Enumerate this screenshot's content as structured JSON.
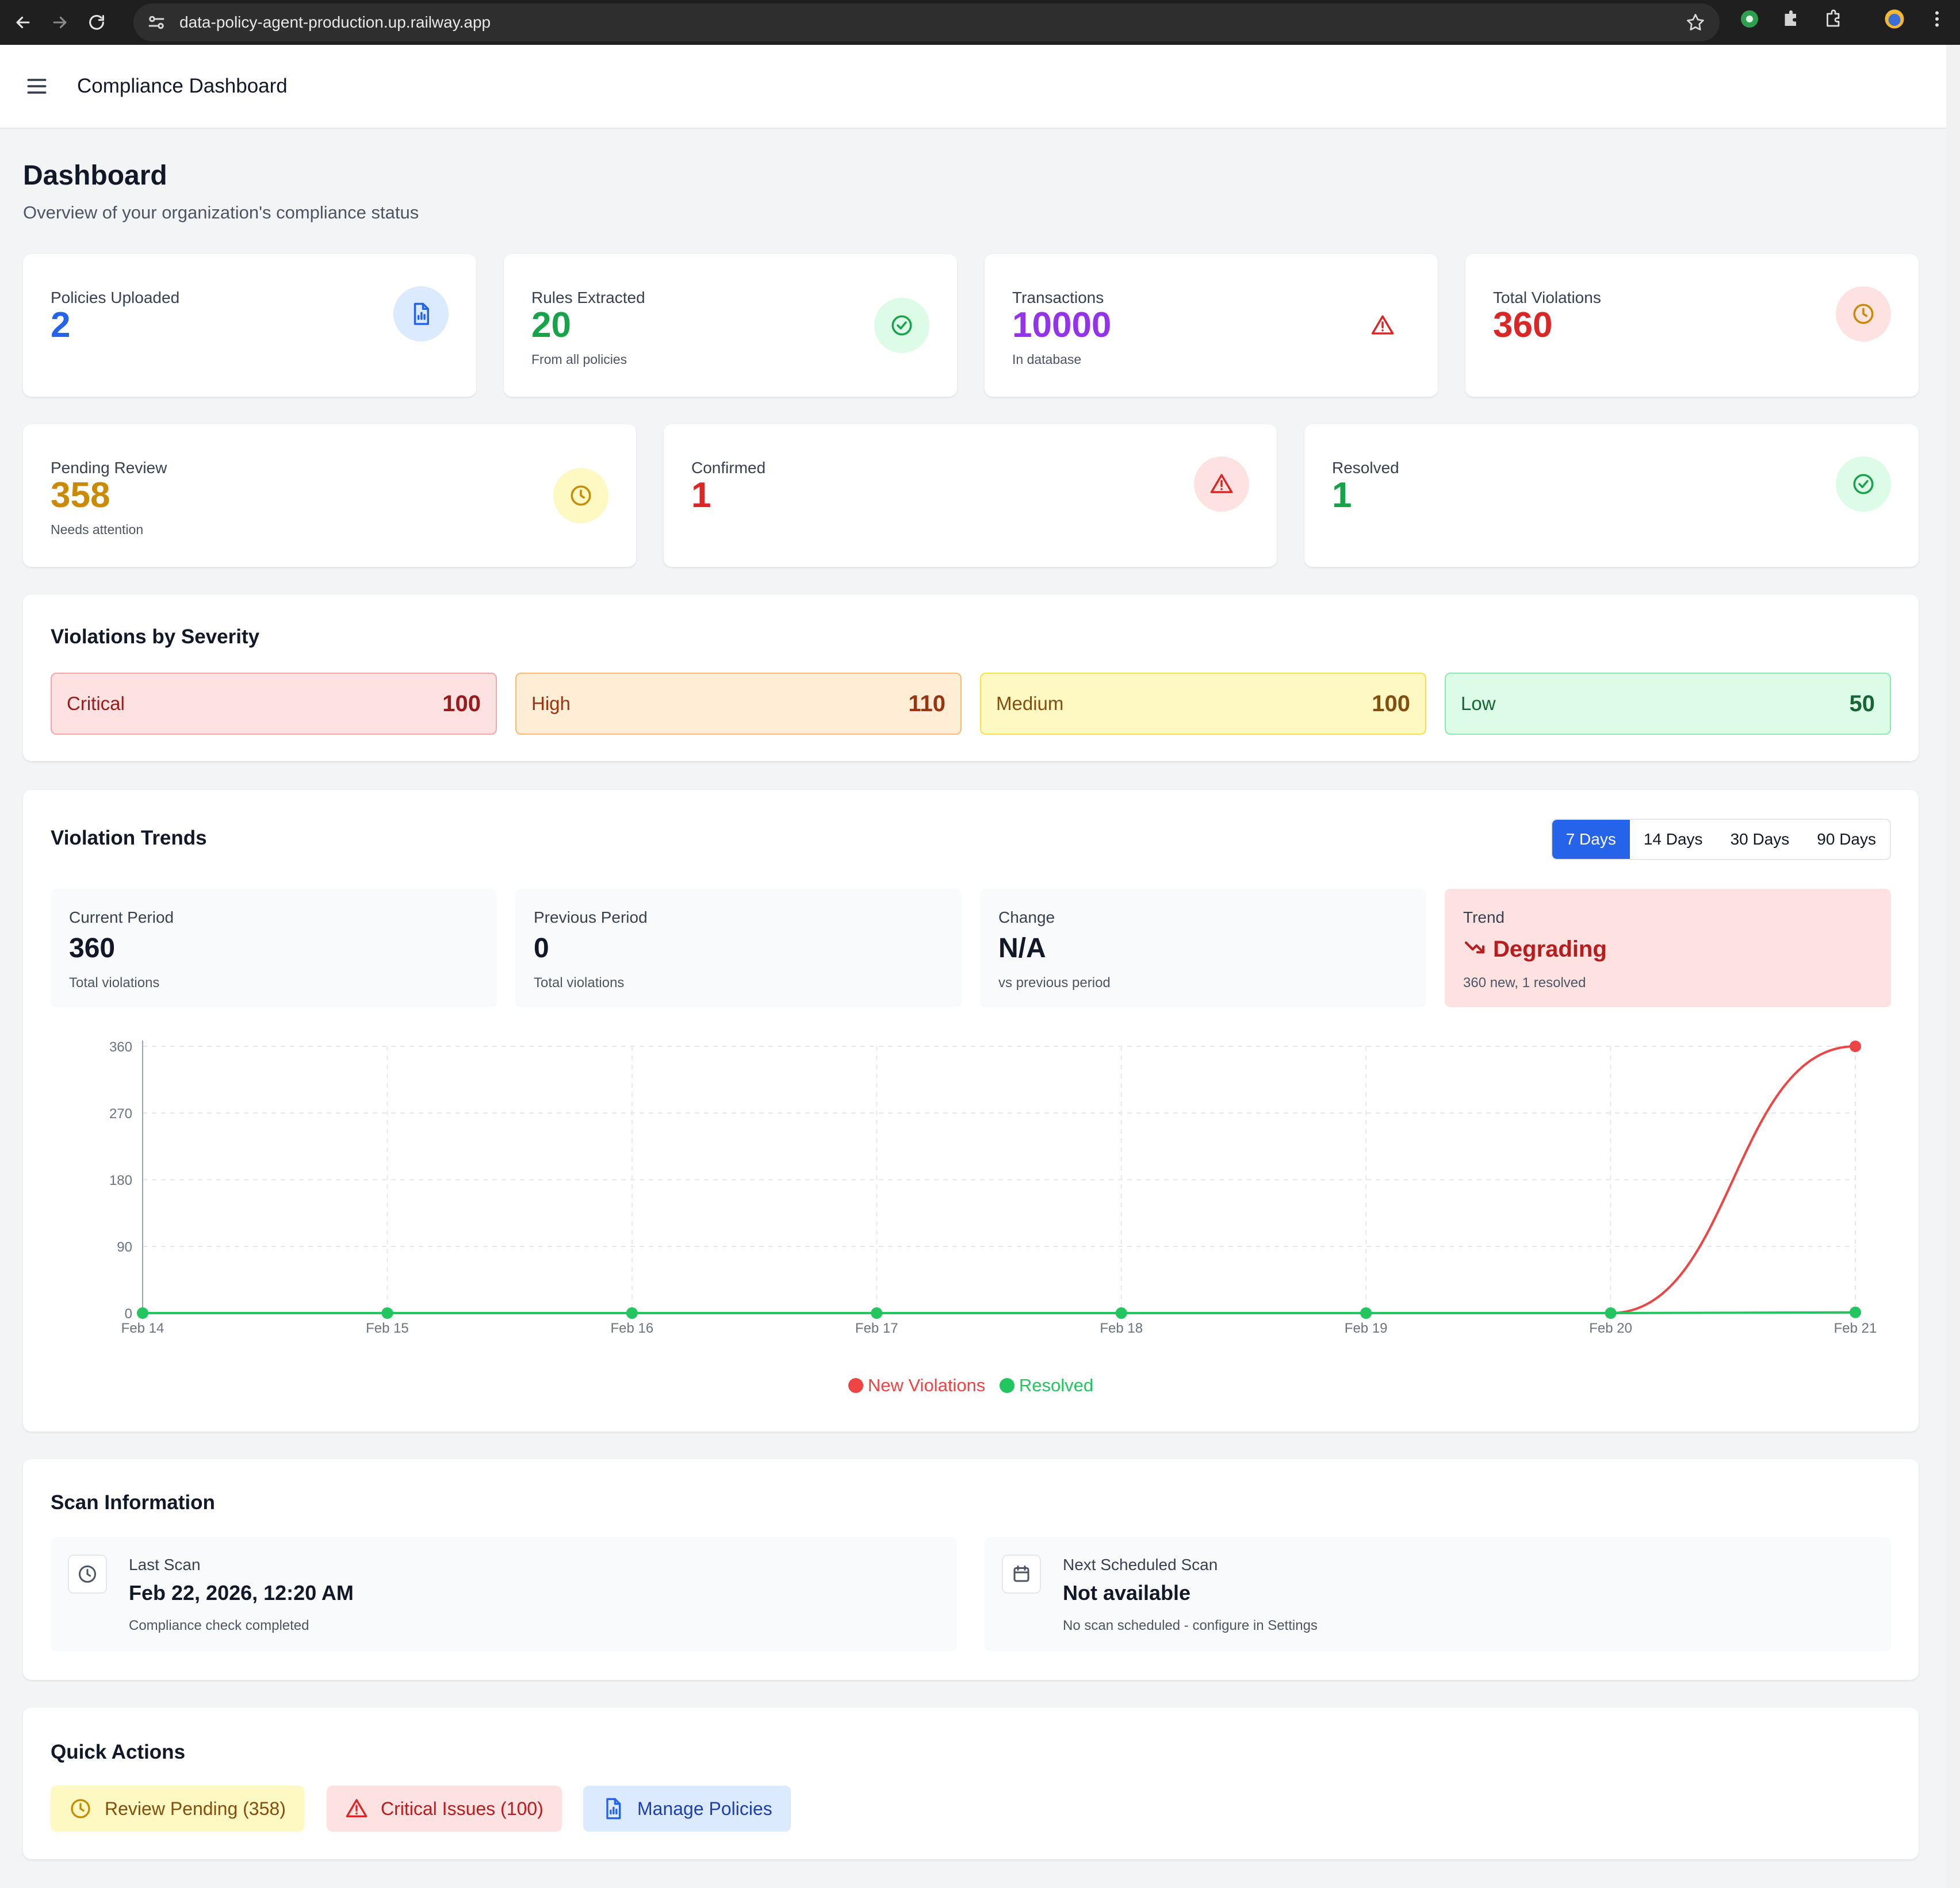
{
  "browser": {
    "url": "data-policy-agent-production.up.railway.app"
  },
  "header": {
    "title": "Compliance Dashboard"
  },
  "page": {
    "title": "Dashboard",
    "subtitle": "Overview of your organization's compliance status"
  },
  "stats_row1": [
    {
      "label": "Policies Uploaded",
      "value": "2",
      "sub": "",
      "color": "#2563eb",
      "icon": "document-chart-icon"
    },
    {
      "label": "Rules Extracted",
      "value": "20",
      "sub": "From all policies",
      "color": "#16a34a",
      "icon": "check-circle-icon"
    },
    {
      "label": "Transactions",
      "value": "10000",
      "sub": "In database",
      "color": "#9333ea",
      "icon": "warning-triangle-icon"
    },
    {
      "label": "Total Violations",
      "value": "360",
      "sub": "",
      "color": "#dc2626",
      "icon": "clock-icon"
    }
  ],
  "stats_row2": [
    {
      "label": "Pending Review",
      "value": "358",
      "sub": "Needs attention",
      "color": "#ca8a04",
      "icon": "clock-icon"
    },
    {
      "label": "Confirmed",
      "value": "1",
      "sub": "",
      "color": "#dc2626",
      "icon": "warning-triangle-icon"
    },
    {
      "label": "Resolved",
      "value": "1",
      "sub": "",
      "color": "#16a34a",
      "icon": "check-circle-icon"
    }
  ],
  "severity": {
    "title": "Violations by Severity",
    "items": [
      {
        "label": "Critical",
        "count": "100",
        "color": "#991b1b"
      },
      {
        "label": "High",
        "count": "110",
        "color": "#9a3412"
      },
      {
        "label": "Medium",
        "count": "100",
        "color": "#854d0e"
      },
      {
        "label": "Low",
        "count": "50",
        "color": "#166534"
      }
    ]
  },
  "trends": {
    "title": "Violation Trends",
    "ranges": [
      "7 Days",
      "14 Days",
      "30 Days",
      "90 Days"
    ],
    "active_range": "7 Days",
    "periods": [
      {
        "label": "Current Period",
        "value": "360",
        "sub": "Total violations"
      },
      {
        "label": "Previous Period",
        "value": "0",
        "sub": "Total violations"
      },
      {
        "label": "Change",
        "value": "N/A",
        "sub": "vs previous period"
      },
      {
        "label": "Trend",
        "value": "Degrading",
        "sub": "360 new, 1 resolved"
      }
    ]
  },
  "chart_data": {
    "type": "line",
    "title": "",
    "xlabel": "",
    "ylabel": "",
    "categories": [
      "Feb 14",
      "Feb 15",
      "Feb 16",
      "Feb 17",
      "Feb 18",
      "Feb 19",
      "Feb 20",
      "Feb 21"
    ],
    "yticks": [
      0,
      90,
      180,
      270,
      360
    ],
    "ylim": [
      0,
      360
    ],
    "grid": true,
    "legend_position": "bottom-center",
    "series": [
      {
        "name": "New Violations",
        "color": "#ef4444",
        "values": [
          0,
          0,
          0,
          0,
          0,
          0,
          0,
          360
        ]
      },
      {
        "name": "Resolved",
        "color": "#22c55e",
        "values": [
          0,
          0,
          0,
          0,
          0,
          0,
          0,
          1
        ]
      }
    ]
  },
  "scan": {
    "title": "Scan Information",
    "last": {
      "label": "Last Scan",
      "value": "Feb 22, 2026, 12:20 AM",
      "sub": "Compliance check completed"
    },
    "next": {
      "label": "Next Scheduled Scan",
      "value": "Not available",
      "sub": "No scan scheduled - configure in Settings"
    }
  },
  "quick_actions": {
    "title": "Quick Actions",
    "items": [
      {
        "label": "Review Pending (358)",
        "color": "#854d0e",
        "icon": "clock-icon"
      },
      {
        "label": "Critical Issues (100)",
        "color": "#b91c1c",
        "icon": "warning-triangle-icon"
      },
      {
        "label": "Manage Policies",
        "color": "#1e40af",
        "icon": "document-chart-icon"
      }
    ]
  }
}
